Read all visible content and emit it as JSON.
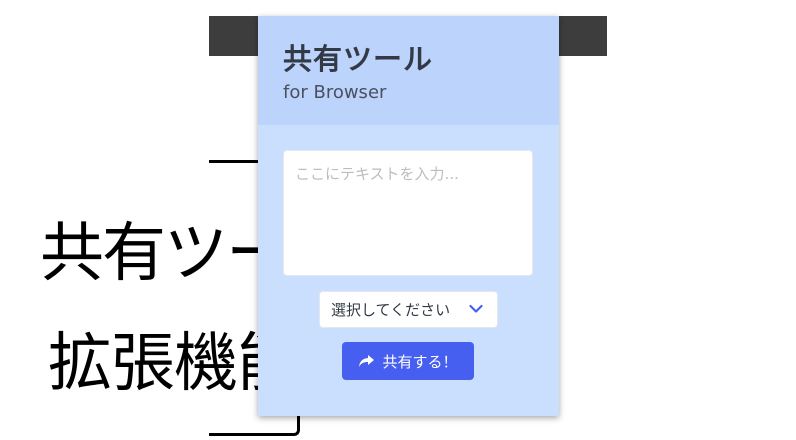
{
  "promo": {
    "title": "共有ツール",
    "subtitle": "拡張機能"
  },
  "popup": {
    "app_name": "共有ツール",
    "app_sub": "for Browser",
    "textarea_placeholder": "ここにテキストを入力...",
    "textarea_value": "",
    "select_label": "選択してください",
    "share_label": "共有する！"
  },
  "icons": {
    "select_chevron": "chevron-down-icon",
    "share": "share-arrow-icon"
  },
  "colors": {
    "popup_background": "#cadffd",
    "header_background": "#bcd3fb",
    "accent": "#465ff1",
    "top_bar": "#3d3d3d"
  }
}
